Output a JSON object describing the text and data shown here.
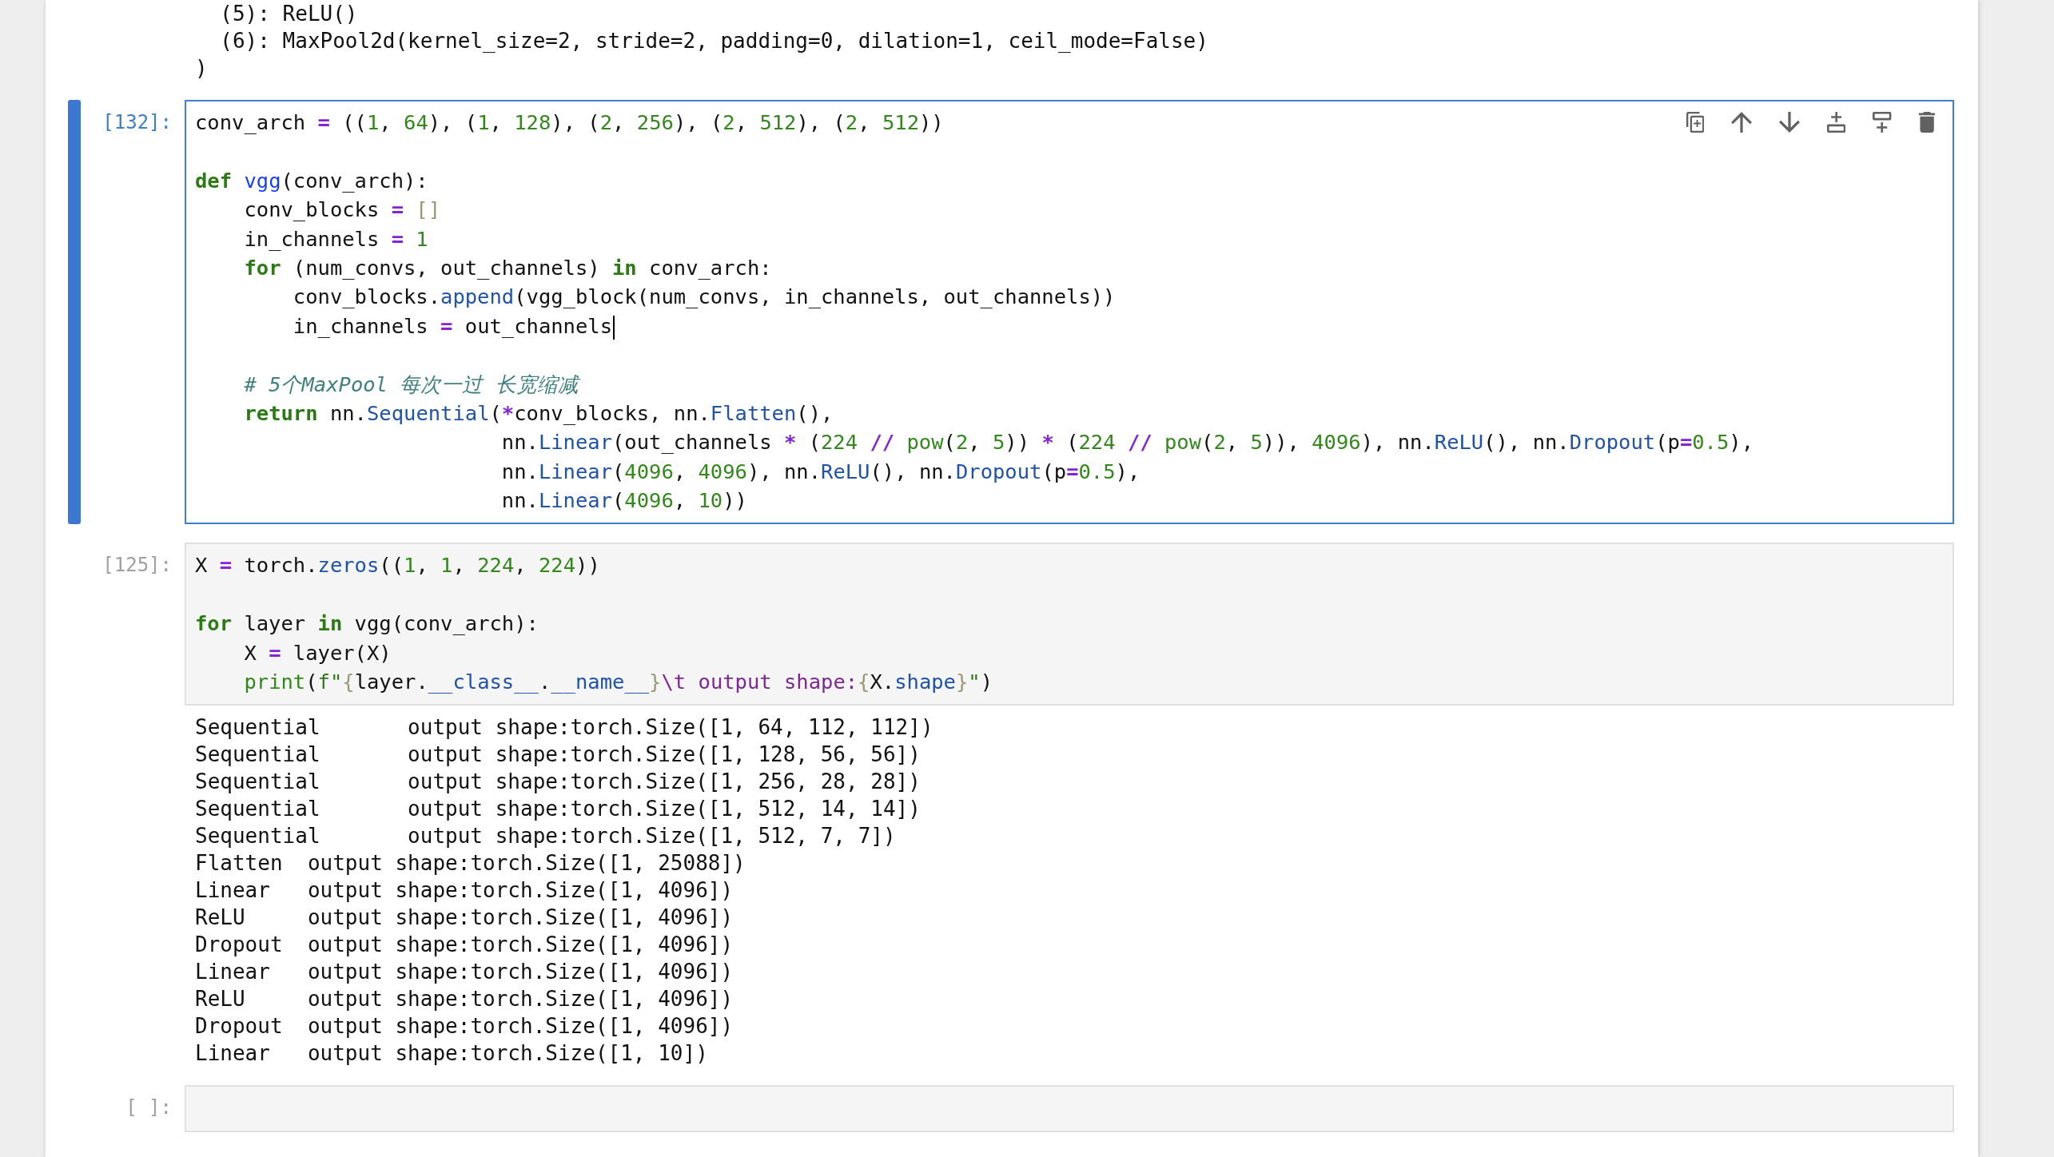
{
  "previous_output": {
    "lines": [
      "  (5): ReLU()",
      "  (6): MaxPool2d(kernel_size=2, stride=2, padding=0, dilation=1, ceil_mode=False)",
      ")"
    ]
  },
  "cells": [
    {
      "prompt": "[132]:",
      "selected": true,
      "source": [
        {
          "lines": [
            {
              "cursor": false,
              "tokens": [
                {
                  "kind": "text",
                  "text": "conv_arch "
                },
                {
                  "kind": "operator",
                  "text": "="
                },
                {
                  "kind": "text",
                  "text": " (("
                },
                {
                  "kind": "number",
                  "text": "1"
                },
                {
                  "kind": "text",
                  "text": ", "
                },
                {
                  "kind": "number",
                  "text": "64"
                },
                {
                  "kind": "text",
                  "text": "), ("
                },
                {
                  "kind": "number",
                  "text": "1"
                },
                {
                  "kind": "text",
                  "text": ", "
                },
                {
                  "kind": "number",
                  "text": "128"
                },
                {
                  "kind": "text",
                  "text": "), ("
                },
                {
                  "kind": "number",
                  "text": "2"
                },
                {
                  "kind": "text",
                  "text": ", "
                },
                {
                  "kind": "number",
                  "text": "256"
                },
                {
                  "kind": "text",
                  "text": "), ("
                },
                {
                  "kind": "number",
                  "text": "2"
                },
                {
                  "kind": "text",
                  "text": ", "
                },
                {
                  "kind": "number",
                  "text": "512"
                },
                {
                  "kind": "text",
                  "text": "), ("
                },
                {
                  "kind": "number",
                  "text": "2"
                },
                {
                  "kind": "text",
                  "text": ", "
                },
                {
                  "kind": "number",
                  "text": "512"
                },
                {
                  "kind": "text",
                  "text": "))"
                }
              ]
            }
          ]
        },
        {
          "lines": [
            {
              "cursor": false,
              "tokens": [
                {
                  "kind": "keyword",
                  "text": "def "
                },
                {
                  "kind": "definition",
                  "text": "vgg"
                },
                {
                  "kind": "text",
                  "text": "(conv_arch):"
                }
              ]
            },
            {
              "cursor": false,
              "tokens": [
                {
                  "kind": "text",
                  "text": "    conv_blocks "
                },
                {
                  "kind": "operator",
                  "text": "="
                },
                {
                  "kind": "bracket",
                  "text": " []"
                }
              ]
            },
            {
              "cursor": false,
              "tokens": [
                {
                  "kind": "text",
                  "text": "    in_channels "
                },
                {
                  "kind": "operator",
                  "text": "="
                },
                {
                  "kind": "number",
                  "text": " 1"
                }
              ]
            },
            {
              "cursor": false,
              "tokens": [
                {
                  "kind": "keyword",
                  "text": "    for"
                },
                {
                  "kind": "text",
                  "text": " (num_convs, out_channels) "
                },
                {
                  "kind": "keyword",
                  "text": "in"
                },
                {
                  "kind": "text",
                  "text": " conv_arch:"
                }
              ]
            },
            {
              "cursor": false,
              "tokens": [
                {
                  "kind": "text",
                  "text": "        conv_blocks."
                },
                {
                  "kind": "property",
                  "text": "append"
                },
                {
                  "kind": "text",
                  "text": "(vgg_block(num_convs, in_channels, out_channels))"
                }
              ]
            },
            {
              "cursor": true,
              "tokens": [
                {
                  "kind": "text",
                  "text": "        in_channels "
                },
                {
                  "kind": "operator",
                  "text": "="
                },
                {
                  "kind": "text",
                  "text": " out_channels"
                }
              ]
            }
          ]
        },
        {
          "lines": [
            {
              "cursor": false,
              "tokens": [
                {
                  "kind": "comment",
                  "text": "    # 5个MaxPool 每次一过 长宽缩减"
                }
              ]
            },
            {
              "cursor": false,
              "tokens": [
                {
                  "kind": "keyword",
                  "text": "    return"
                },
                {
                  "kind": "text",
                  "text": " nn."
                },
                {
                  "kind": "property",
                  "text": "Sequential"
                },
                {
                  "kind": "text",
                  "text": "("
                },
                {
                  "kind": "operator",
                  "text": "*"
                },
                {
                  "kind": "text",
                  "text": "conv_blocks, nn."
                },
                {
                  "kind": "property",
                  "text": "Flatten"
                },
                {
                  "kind": "text",
                  "text": "(),"
                }
              ]
            },
            {
              "cursor": false,
              "tokens": [
                {
                  "kind": "text",
                  "text": "                         nn."
                },
                {
                  "kind": "property",
                  "text": "Linear"
                },
                {
                  "kind": "text",
                  "text": "(out_channels "
                },
                {
                  "kind": "operator",
                  "text": "*"
                },
                {
                  "kind": "text",
                  "text": " ("
                },
                {
                  "kind": "number",
                  "text": "224"
                },
                {
                  "kind": "operator",
                  "text": " //"
                },
                {
                  "kind": "builtin",
                  "text": " pow"
                },
                {
                  "kind": "text",
                  "text": "("
                },
                {
                  "kind": "number",
                  "text": "2"
                },
                {
                  "kind": "text",
                  "text": ", "
                },
                {
                  "kind": "number",
                  "text": "5"
                },
                {
                  "kind": "text",
                  "text": ")) "
                },
                {
                  "kind": "operator",
                  "text": "*"
                },
                {
                  "kind": "text",
                  "text": " ("
                },
                {
                  "kind": "number",
                  "text": "224"
                },
                {
                  "kind": "operator",
                  "text": " //"
                },
                {
                  "kind": "builtin",
                  "text": " pow"
                },
                {
                  "kind": "text",
                  "text": "("
                },
                {
                  "kind": "number",
                  "text": "2"
                },
                {
                  "kind": "text",
                  "text": ", "
                },
                {
                  "kind": "number",
                  "text": "5"
                },
                {
                  "kind": "text",
                  "text": ")), "
                },
                {
                  "kind": "number",
                  "text": "4096"
                },
                {
                  "kind": "text",
                  "text": "), nn."
                },
                {
                  "kind": "property",
                  "text": "ReLU"
                },
                {
                  "kind": "text",
                  "text": "(), nn."
                },
                {
                  "kind": "property",
                  "text": "Dropout"
                },
                {
                  "kind": "text",
                  "text": "(p"
                },
                {
                  "kind": "operator",
                  "text": "="
                },
                {
                  "kind": "number",
                  "text": "0.5"
                },
                {
                  "kind": "text",
                  "text": "),"
                }
              ]
            },
            {
              "cursor": false,
              "tokens": [
                {
                  "kind": "text",
                  "text": "                         nn."
                },
                {
                  "kind": "property",
                  "text": "Linear"
                },
                {
                  "kind": "text",
                  "text": "("
                },
                {
                  "kind": "number",
                  "text": "4096"
                },
                {
                  "kind": "text",
                  "text": ", "
                },
                {
                  "kind": "number",
                  "text": "4096"
                },
                {
                  "kind": "text",
                  "text": "), nn."
                },
                {
                  "kind": "property",
                  "text": "ReLU"
                },
                {
                  "kind": "text",
                  "text": "(), nn."
                },
                {
                  "kind": "property",
                  "text": "Dropout"
                },
                {
                  "kind": "text",
                  "text": "(p"
                },
                {
                  "kind": "operator",
                  "text": "="
                },
                {
                  "kind": "number",
                  "text": "0.5"
                },
                {
                  "kind": "text",
                  "text": "),"
                }
              ]
            },
            {
              "cursor": false,
              "tokens": [
                {
                  "kind": "text",
                  "text": "                         nn."
                },
                {
                  "kind": "property",
                  "text": "Linear"
                },
                {
                  "kind": "text",
                  "text": "("
                },
                {
                  "kind": "number",
                  "text": "4096"
                },
                {
                  "kind": "text",
                  "text": ", "
                },
                {
                  "kind": "number",
                  "text": "10"
                },
                {
                  "kind": "text",
                  "text": "))"
                }
              ]
            }
          ]
        }
      ]
    },
    {
      "prompt": "[125]:",
      "selected": false,
      "source": [
        {
          "lines": [
            {
              "tokens": [
                {
                  "kind": "text",
                  "text": "X "
                },
                {
                  "kind": "operator",
                  "text": "="
                },
                {
                  "kind": "text",
                  "text": " torch."
                },
                {
                  "kind": "property",
                  "text": "zeros"
                },
                {
                  "kind": "text",
                  "text": "(("
                },
                {
                  "kind": "number",
                  "text": "1"
                },
                {
                  "kind": "text",
                  "text": ", "
                },
                {
                  "kind": "number",
                  "text": "1"
                },
                {
                  "kind": "text",
                  "text": ", "
                },
                {
                  "kind": "number",
                  "text": "224"
                },
                {
                  "kind": "text",
                  "text": ", "
                },
                {
                  "kind": "number",
                  "text": "224"
                },
                {
                  "kind": "text",
                  "text": "))"
                }
              ]
            }
          ]
        },
        {
          "lines": [
            {
              "tokens": [
                {
                  "kind": "keyword",
                  "text": "for"
                },
                {
                  "kind": "text",
                  "text": " layer "
                },
                {
                  "kind": "keyword",
                  "text": "in"
                },
                {
                  "kind": "text",
                  "text": " vgg(conv_arch):"
                }
              ]
            },
            {
              "tokens": [
                {
                  "kind": "text",
                  "text": "    X "
                },
                {
                  "kind": "operator",
                  "text": "="
                },
                {
                  "kind": "text",
                  "text": " layer(X)"
                }
              ]
            },
            {
              "tokens": [
                {
                  "kind": "builtin",
                  "text": "    print"
                },
                {
                  "kind": "text",
                  "text": "("
                },
                {
                  "kind": "quote",
                  "text": "f\""
                },
                {
                  "kind": "bracket",
                  "text": "{"
                },
                {
                  "kind": "text",
                  "text": "layer."
                },
                {
                  "kind": "property",
                  "text": "__class__"
                },
                {
                  "kind": "text",
                  "text": "."
                },
                {
                  "kind": "property",
                  "text": "__name__"
                },
                {
                  "kind": "bracket",
                  "text": "}"
                },
                {
                  "kind": "string",
                  "text": "\\t output shape:"
                },
                {
                  "kind": "bracket",
                  "text": "{"
                },
                {
                  "kind": "text",
                  "text": "X."
                },
                {
                  "kind": "property",
                  "text": "shape"
                },
                {
                  "kind": "bracket",
                  "text": "}"
                },
                {
                  "kind": "quote",
                  "text": "\""
                },
                {
                  "kind": "text",
                  "text": ")"
                }
              ]
            }
          ]
        }
      ],
      "output": {
        "lines": [
          "Sequential\t output shape:torch.Size([1, 64, 112, 112])",
          "Sequential\t output shape:torch.Size([1, 128, 56, 56])",
          "Sequential\t output shape:torch.Size([1, 256, 28, 28])",
          "Sequential\t output shape:torch.Size([1, 512, 14, 14])",
          "Sequential\t output shape:torch.Size([1, 512, 7, 7])",
          "Flatten\t output shape:torch.Size([1, 25088])",
          "Linear\t output shape:torch.Size([1, 4096])",
          "ReLU\t output shape:torch.Size([1, 4096])",
          "Dropout\t output shape:torch.Size([1, 4096])",
          "Linear\t output shape:torch.Size([1, 4096])",
          "ReLU\t output shape:torch.Size([1, 4096])",
          "Dropout\t output shape:torch.Size([1, 4096])",
          "Linear\t output shape:torch.Size([1, 10])"
        ]
      }
    },
    {
      "prompt": "[ ]:",
      "selected": false
    }
  ]
}
